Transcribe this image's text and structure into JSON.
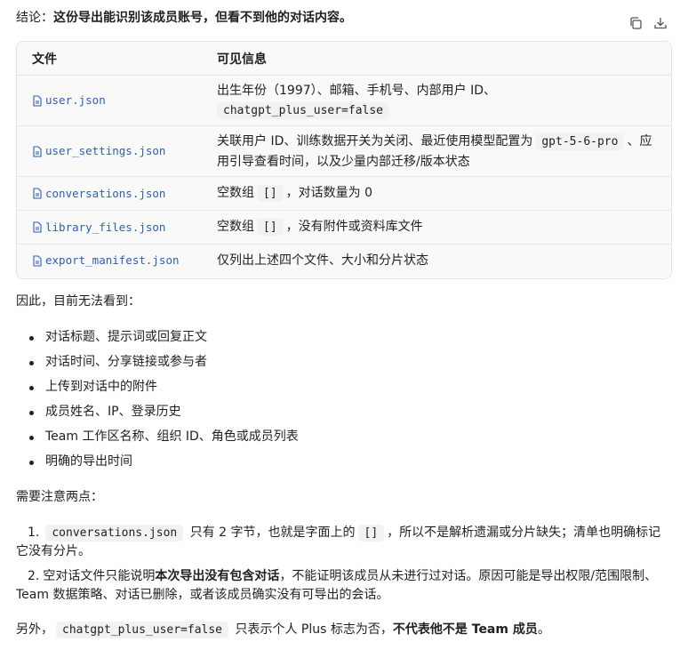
{
  "conclusion": {
    "prefix": "结论：",
    "bold": "这份导出能识别该成员账号，但看不到他的对话内容。"
  },
  "toolbar": {
    "copy_icon": "copy-icon",
    "download_icon": "download-icon"
  },
  "table": {
    "headers": [
      "文件",
      "可见信息"
    ],
    "rows": [
      {
        "file": "user.json",
        "info_a": "出生年份（1997）、邮箱、手机号、内部用户 ID、",
        "info_code": "chatgpt_plus_user=false",
        "info_b": ""
      },
      {
        "file": "user_settings.json",
        "info_a": "关联用户 ID、训练数据开关为关闭、最近使用模型配置为",
        "info_code": "gpt-5-6-pro",
        "info_b": "、应用引导查看时间，以及少量内部迁移/版本状态"
      },
      {
        "file": "conversations.json",
        "info_a": "空数组",
        "info_code": "[]",
        "info_b": "，对话数量为 0"
      },
      {
        "file": "library_files.json",
        "info_a": "空数组",
        "info_code": "[]",
        "info_b": "，没有附件或资料库文件"
      },
      {
        "file": "export_manifest.json",
        "info_a": "仅列出上述四个文件、大小和分片状态",
        "info_code": "",
        "info_b": ""
      }
    ]
  },
  "therefore": "因此，目前无法看到：",
  "bullets": [
    "对话标题、提示词或回复正文",
    "对话时间、分享链接或参与者",
    "上传到对话中的附件",
    "成员姓名、IP、登录历史",
    "Team 工作区名称、组织 ID、角色或成员列表",
    "明确的导出时间"
  ],
  "note_title": "需要注意两点：",
  "notes": {
    "n1": "1.",
    "n1_code1": "conversations.json",
    "n1_a": "只有 2 字节，也就是字面上的",
    "n1_code2": "[]",
    "n1_b": "，所以不是解析遗漏或分片缺失；清单也明确标记它没有分片。",
    "n2": "2.",
    "n2_a": "空对话文件只能说明",
    "n2_bold": "本次导出没有包含对话",
    "n2_b": "，不能证明该成员从未进行过对话。原因可能是导出权限/范围限制、Team 数据策略、对话已删除，或者该成员确实没有可导出的会话。"
  },
  "final": {
    "a": "另外，",
    "code": "chatgpt_plus_user=false",
    "b": "只表示个人 Plus 标志为否，",
    "bold": "不代表他不是 Team 成员",
    "c": "。"
  }
}
